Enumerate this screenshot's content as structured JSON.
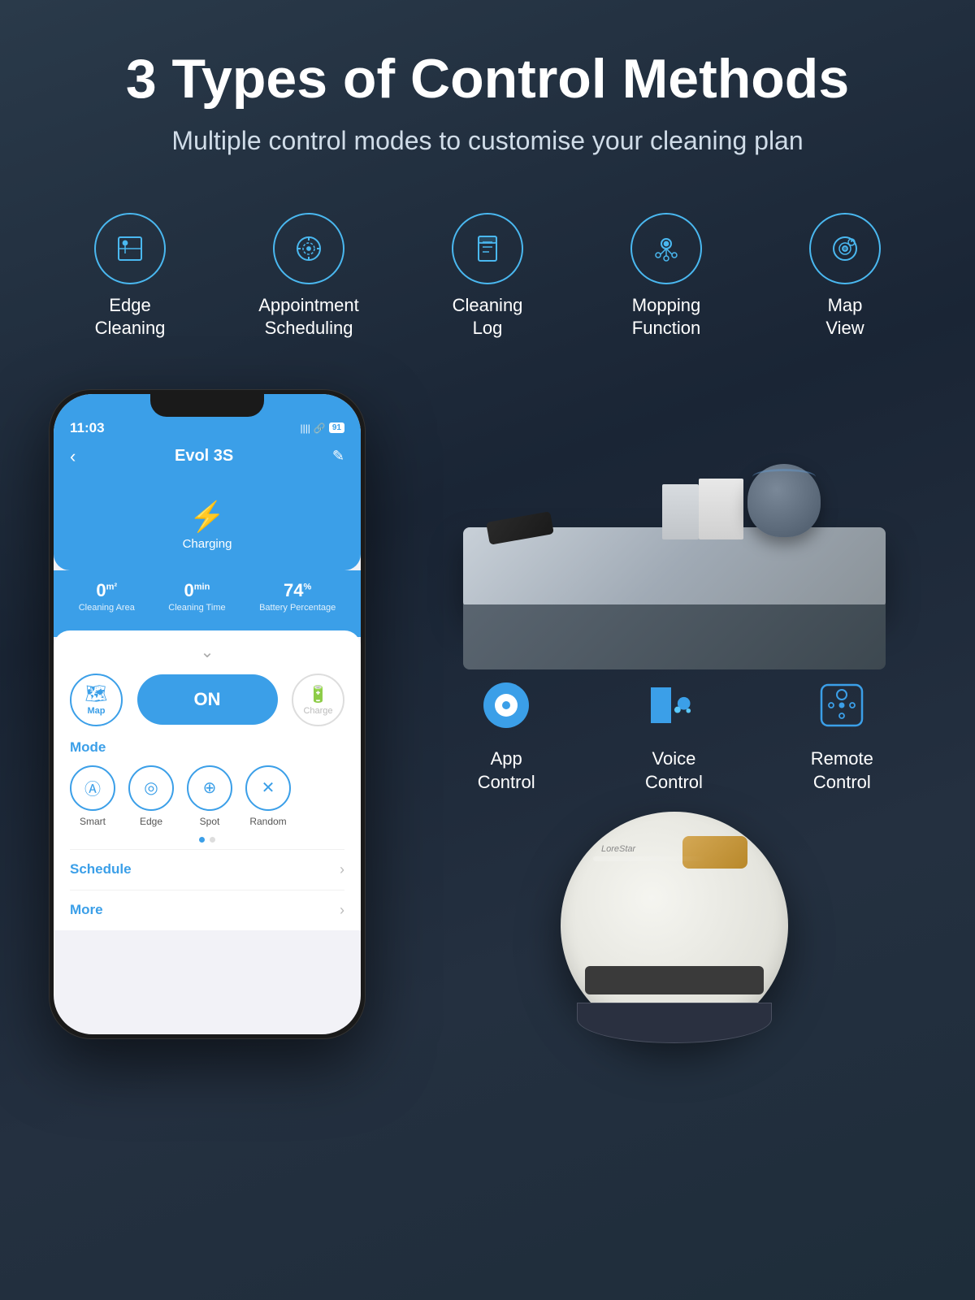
{
  "header": {
    "main_title": "3 Types of Control Methods",
    "subtitle": "Multiple control modes to customise your cleaning plan"
  },
  "features": [
    {
      "id": "edge-cleaning",
      "label": "Edge\nCleaning",
      "icon": "edge"
    },
    {
      "id": "appointment-scheduling",
      "label": "Appointment\nScheduling",
      "icon": "calendar"
    },
    {
      "id": "cleaning-log",
      "label": "Cleaning\nLog",
      "icon": "log"
    },
    {
      "id": "mopping-function",
      "label": "Mopping\nFunction",
      "icon": "mopping"
    },
    {
      "id": "map-view",
      "label": "Map\nView",
      "icon": "map"
    }
  ],
  "phone": {
    "time": "11:03",
    "device_name": "Evol 3S",
    "status": "Charging",
    "stats": {
      "area": "0",
      "area_unit": "m²",
      "area_label": "Cleaning Area",
      "time": "0",
      "time_unit": "min",
      "time_label": "Cleaning Time",
      "battery": "74",
      "battery_unit": "%",
      "battery_label": "Battery Percentage"
    },
    "buttons": {
      "map": "Map",
      "on": "ON",
      "charge": "Charge"
    },
    "modes": {
      "label": "Mode",
      "items": [
        "Smart",
        "Edge",
        "Spot",
        "Random"
      ]
    },
    "menu": {
      "schedule": "Schedule",
      "more": "More"
    }
  },
  "control_methods": [
    {
      "id": "app-control",
      "label": "App\nControl",
      "icon_type": "app"
    },
    {
      "id": "voice-control",
      "label": "Voice\nControl",
      "icon_type": "voice"
    },
    {
      "id": "remote-control",
      "label": "Remote\nControl",
      "icon_type": "remote"
    }
  ]
}
